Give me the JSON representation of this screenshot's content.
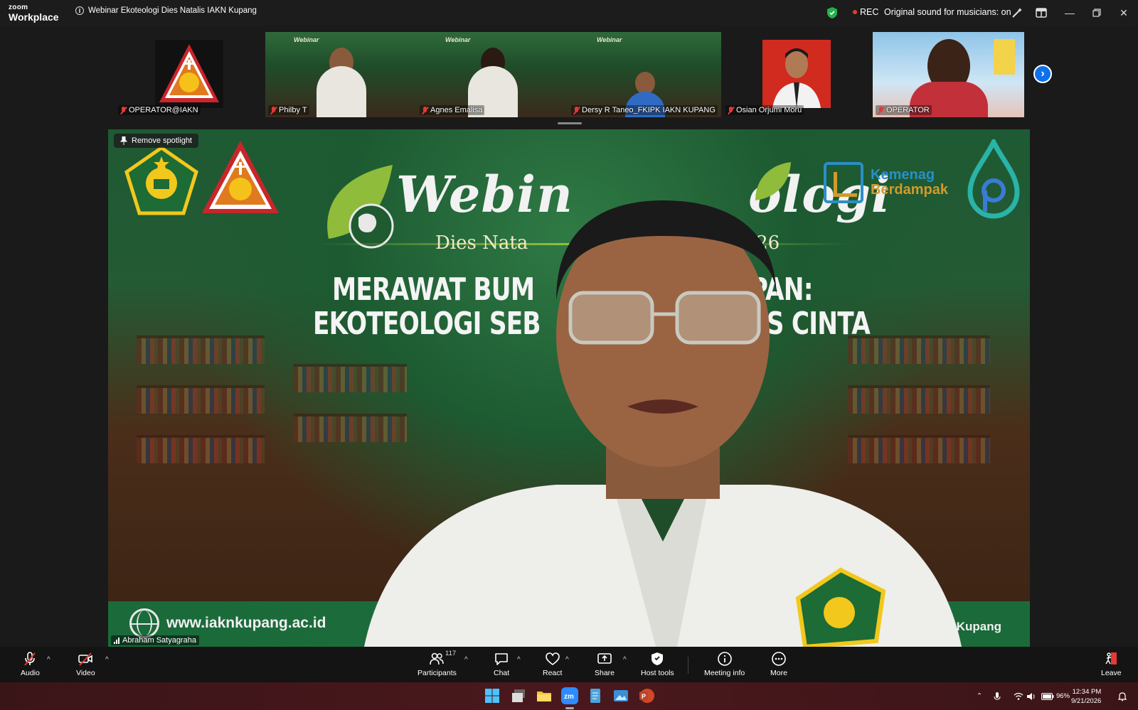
{
  "app": {
    "brand_top": "zoom",
    "brand_bottom": "Workplace",
    "meeting_title": "Webinar Ekoteologi Dies Natalis IAKN Kupang"
  },
  "status": {
    "rec_label": "REC",
    "original_sound": "Original sound for musicians: on"
  },
  "gallery": {
    "tiles": [
      {
        "name": "OPERATOR@IAKN"
      },
      {
        "name": "Philby T"
      },
      {
        "name": "Agnes Emalisa"
      },
      {
        "name": "Dersy R Taneo_FKIPK IAKN KUPANG"
      },
      {
        "name": "Osian Orjumi Moru"
      },
      {
        "name": "OPERATOR"
      }
    ]
  },
  "main": {
    "spotlight_label": "Remove spotlight",
    "banner_title": "Webin",
    "banner_title_right": "ologi",
    "dies_left": "Dies Nata",
    "dies_year": "2026",
    "heading1_left": "MERAWAT BUM",
    "heading1_right": "DUPAN:",
    "heading2_left": "EKOTEOLOGI SEB",
    "heading2_right": "AS CINTA",
    "kemenag": "Kemenag",
    "berdampak": "Berdampak",
    "website": "www.iaknkupang.ac.id",
    "footer_right": "IAKN Kupang",
    "speaker_name": "Abraham Satyagraha"
  },
  "controls": {
    "audio": "Audio",
    "video": "Video",
    "participants": "Participants",
    "participants_count": "117",
    "chat": "Chat",
    "react": "React",
    "share": "Share",
    "host_tools": "Host tools",
    "meeting_info": "Meeting info",
    "more": "More",
    "leave": "Leave"
  },
  "taskbar": {
    "battery": "96%",
    "time": "12:34 PM",
    "date": "9/21/2026"
  },
  "colors": {
    "accent": "#0e71eb",
    "rec": "#e53935",
    "leave": "#e53935",
    "banner_green": "#1d5a31"
  }
}
